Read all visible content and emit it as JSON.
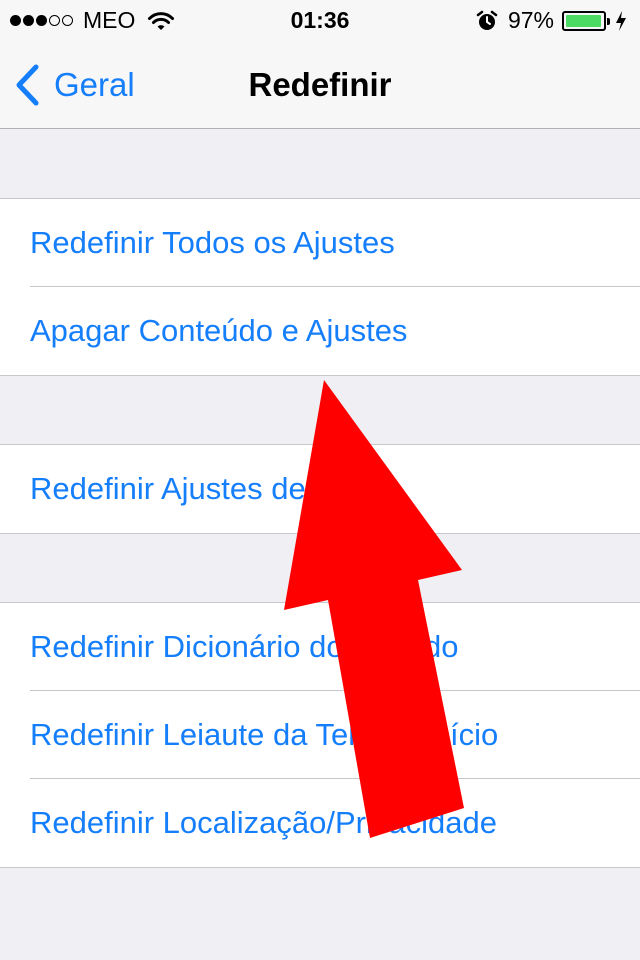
{
  "status_bar": {
    "carrier": "MEO",
    "time": "01:36",
    "battery_percent": "97%",
    "battery_level": 0.97,
    "signal_bars_filled": 3,
    "signal_bars_total": 5
  },
  "nav": {
    "back_label": "Geral",
    "title": "Redefinir"
  },
  "groups": [
    {
      "items": [
        {
          "label": "Redefinir Todos os Ajustes"
        },
        {
          "label": "Apagar Conteúdo e Ajustes"
        }
      ]
    },
    {
      "items": [
        {
          "label": "Redefinir Ajustes de Rede"
        }
      ]
    },
    {
      "items": [
        {
          "label": "Redefinir Dicionário do Teclado"
        },
        {
          "label": "Redefinir Leiaute da Tela de Início"
        },
        {
          "label": "Redefinir Localização/Privacidade"
        }
      ]
    }
  ],
  "colors": {
    "tint": "#157efb",
    "annotation_arrow": "#ff0000",
    "background": "#efeff4",
    "battery_fill": "#4cd964"
  },
  "icons": [
    "signal-dots",
    "wifi-icon",
    "alarm-icon",
    "battery-icon",
    "charging-bolt-icon",
    "chevron-left-icon"
  ]
}
